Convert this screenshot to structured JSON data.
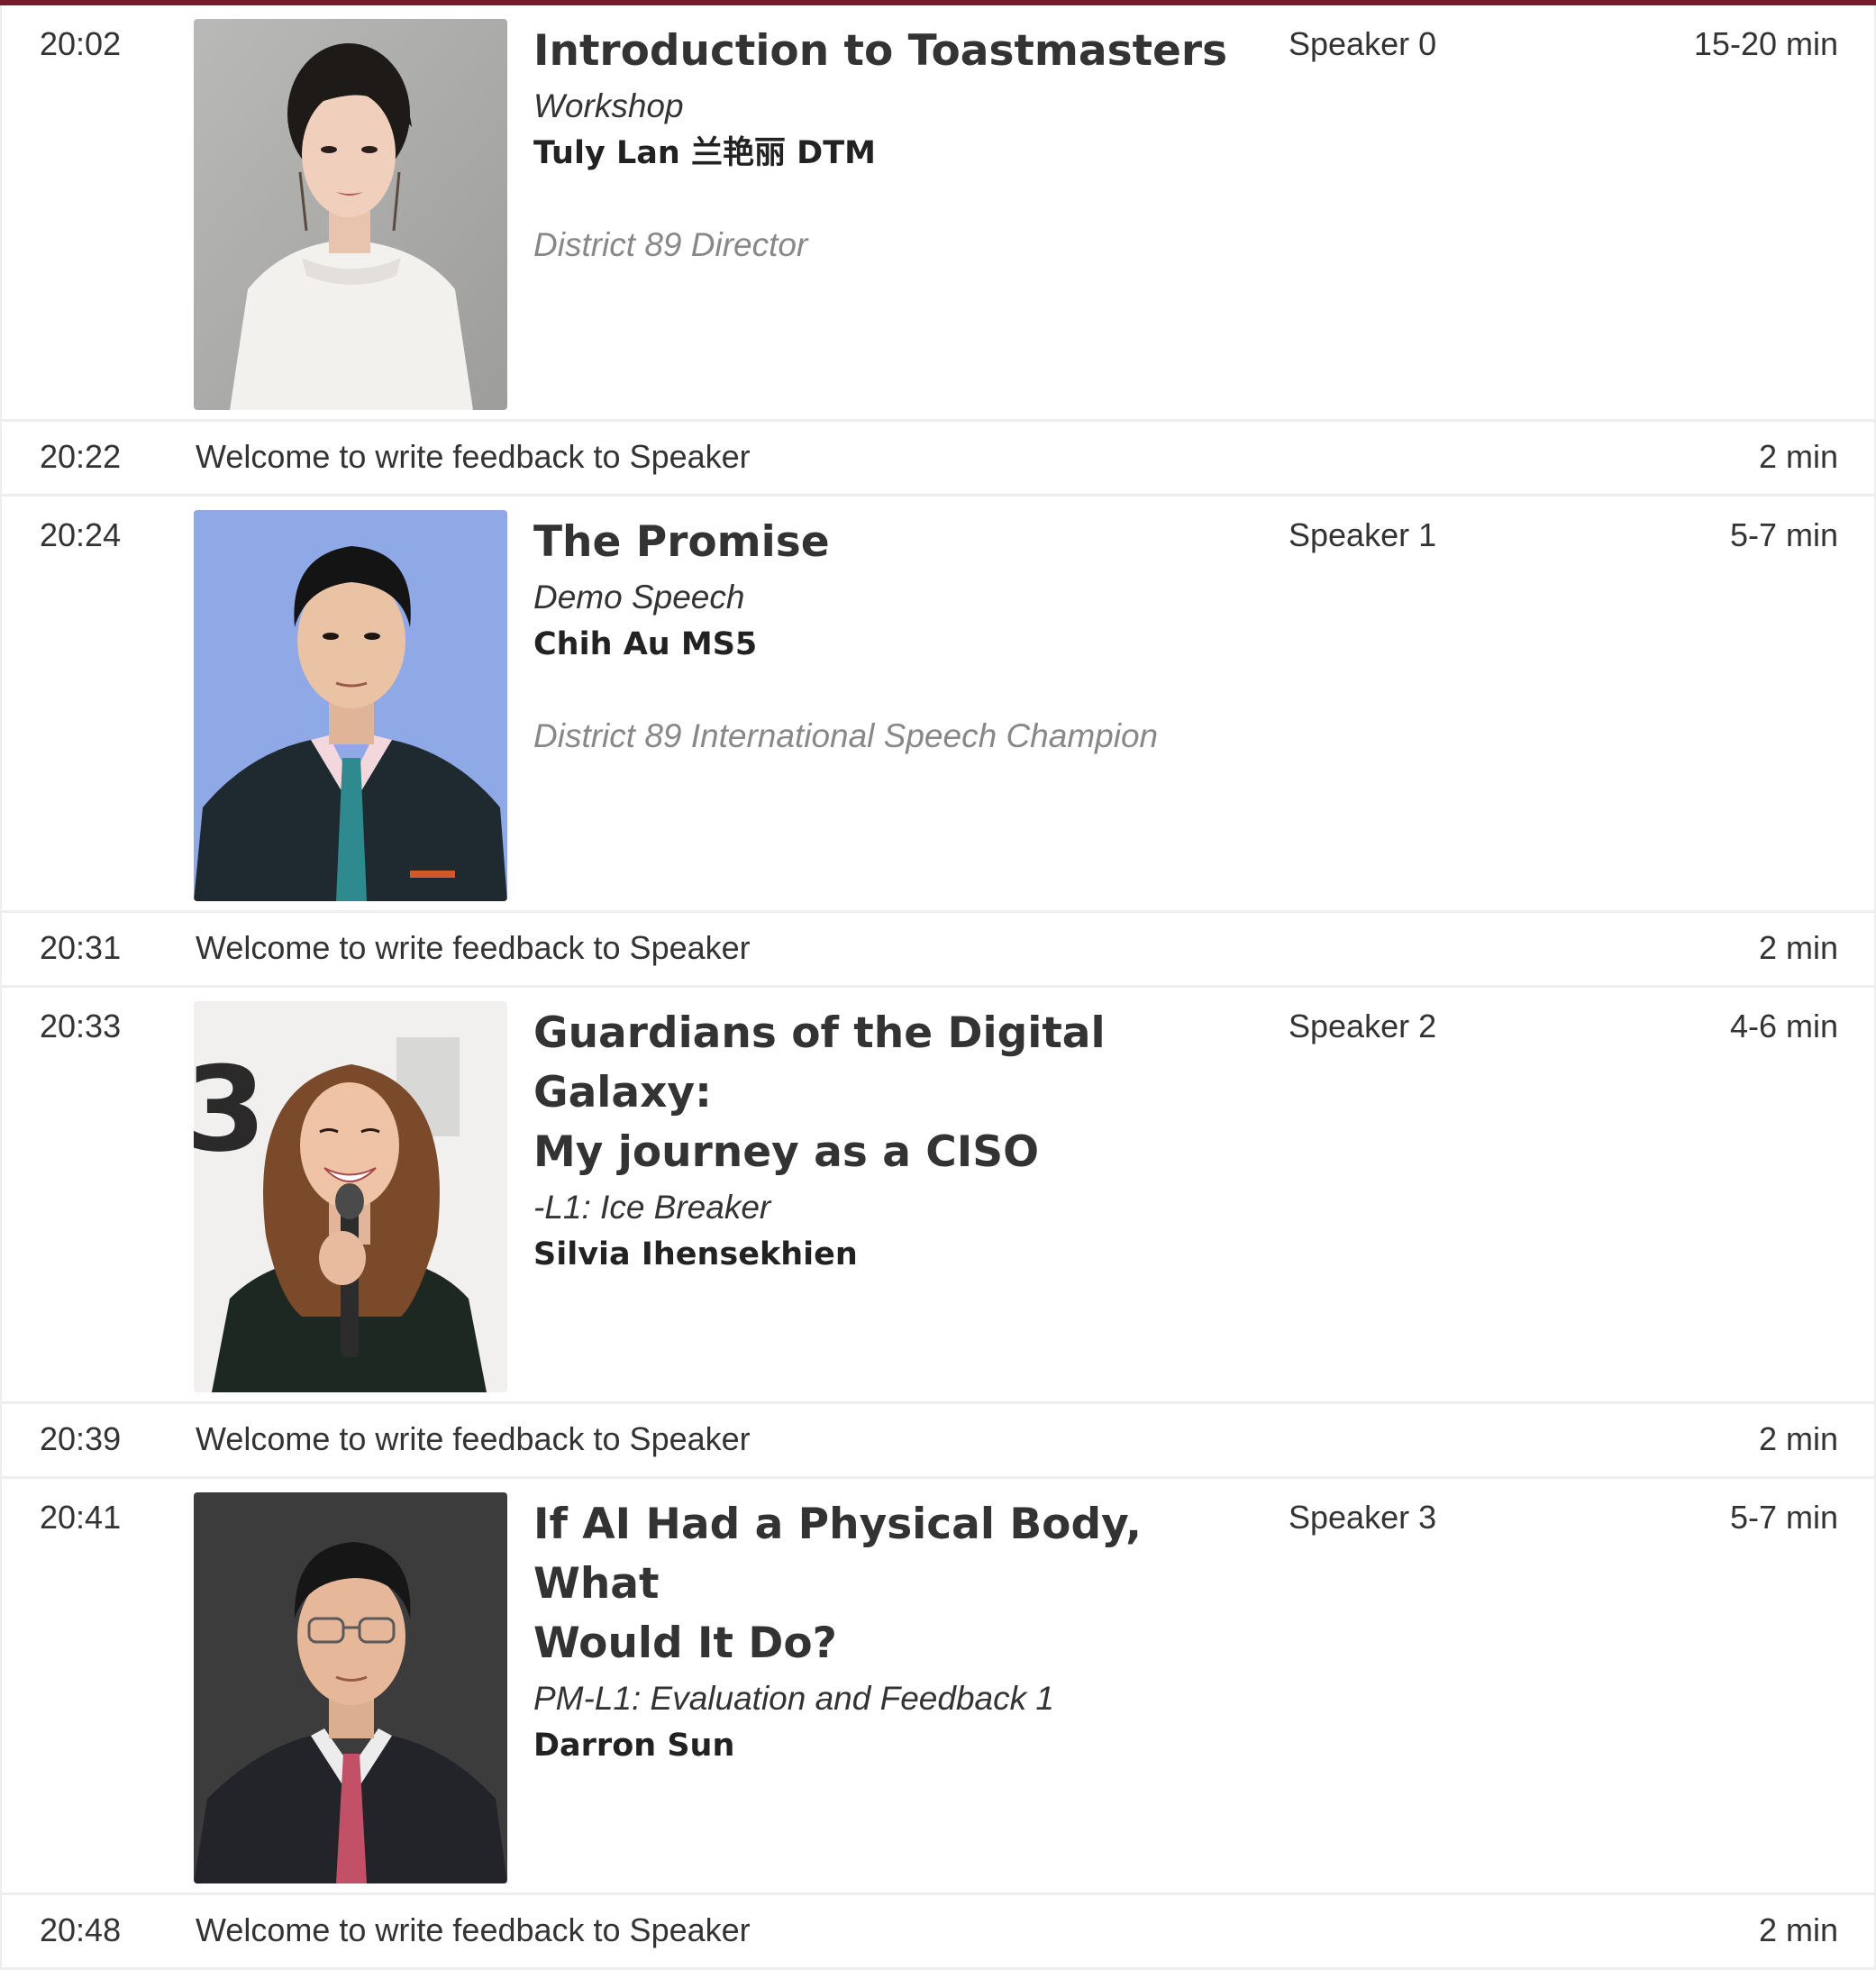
{
  "agenda": [
    {
      "type": "speech",
      "time": "20:02",
      "title": "Introduction to Toastmasters",
      "subtitle": "Workshop",
      "speaker": "Tuly Lan 兰艳丽 DTM",
      "description": "District 89 Director",
      "role": "Speaker 0",
      "duration": "15-20 min",
      "photo": "portrait-woman-white-blouse"
    },
    {
      "type": "feedback",
      "time": "20:22",
      "text": "Welcome to write feedback to Speaker",
      "duration": "2 min"
    },
    {
      "type": "speech",
      "time": "20:24",
      "title": "The Promise",
      "subtitle": "Demo Speech",
      "speaker": "Chih Au MS5",
      "description": "District 89 International Speech Champion",
      "role": "Speaker 1",
      "duration": "5-7 min",
      "photo": "portrait-man-suit-blue-background"
    },
    {
      "type": "feedback",
      "time": "20:31",
      "text": "Welcome to write feedback to Speaker",
      "duration": "2 min"
    },
    {
      "type": "speech",
      "time": "20:33",
      "title_lines": [
        "Guardians of the Digital Galaxy:",
        "My journey as a CISO"
      ],
      "subtitle": "-L1: Ice Breaker",
      "speaker": "Silvia Ihensekhien",
      "description": "",
      "role": "Speaker 2",
      "duration": "4-6 min",
      "photo": "portrait-woman-microphone"
    },
    {
      "type": "feedback",
      "time": "20:39",
      "text": "Welcome to write feedback to Speaker",
      "duration": "2 min"
    },
    {
      "type": "speech",
      "time": "20:41",
      "title_lines": [
        "If AI Had a Physical Body, What",
        "Would It Do?"
      ],
      "subtitle": "PM-L1: Evaluation and Feedback 1",
      "speaker": "Darron Sun",
      "description": "",
      "role": "Speaker 3",
      "duration": "5-7 min",
      "photo": "portrait-man-glasses-dark-background"
    },
    {
      "type": "feedback",
      "time": "20:48",
      "text": "Welcome to write feedback to Speaker",
      "duration": "2 min"
    }
  ],
  "colors": {
    "accent_bar": "#7a1a2c",
    "description_text": "#888888",
    "divider": "#eeeeee"
  }
}
